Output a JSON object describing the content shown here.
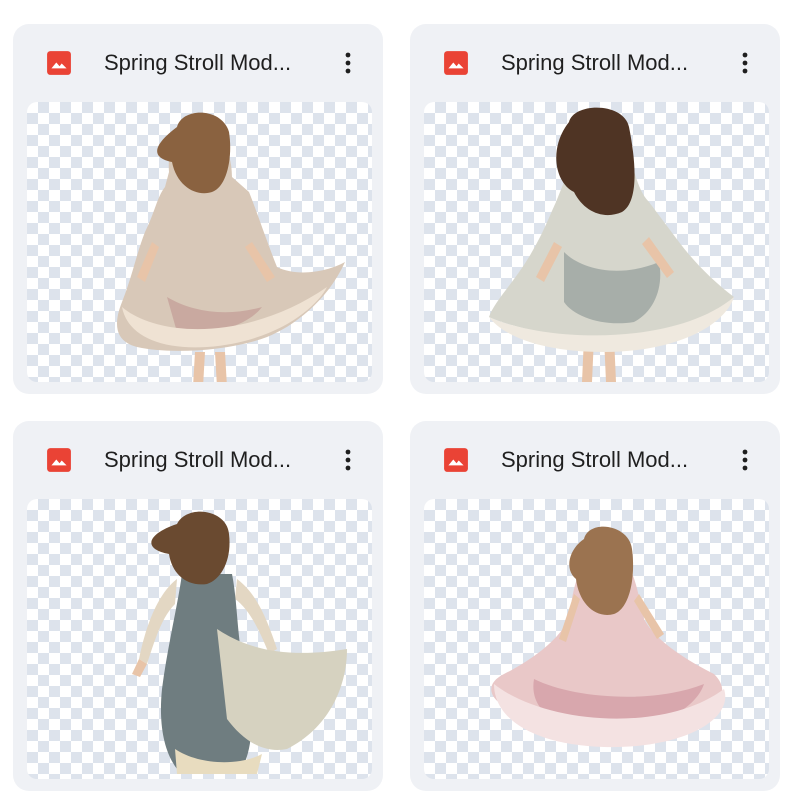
{
  "files": [
    {
      "name": "Spring Stroll Mod...",
      "icon": "image-file-icon",
      "dress": "#d8c8b8",
      "accent": "#c9a9a0",
      "hair": "#8a6240",
      "trim": "#efe2d3"
    },
    {
      "name": "Spring Stroll Mod...",
      "icon": "image-file-icon",
      "dress": "#d6d6cc",
      "accent": "#a7aea9",
      "hair": "#4f3424",
      "trim": "#efe9df"
    },
    {
      "name": "Spring Stroll Mod...",
      "icon": "image-file-icon",
      "dress": "#6f7d80",
      "accent": "#d6d2c0",
      "hair": "#6a4a30",
      "trim": "#e8dcbf"
    },
    {
      "name": "Spring Stroll Mod...",
      "icon": "image-file-icon",
      "dress": "#e9c8c8",
      "accent": "#d8a7ad",
      "hair": "#9b7350",
      "trim": "#f4e2e2"
    }
  ],
  "colors": {
    "icon_red": "#ea4335",
    "card_bg": "#eff1f5",
    "text": "#1f1f1f"
  }
}
